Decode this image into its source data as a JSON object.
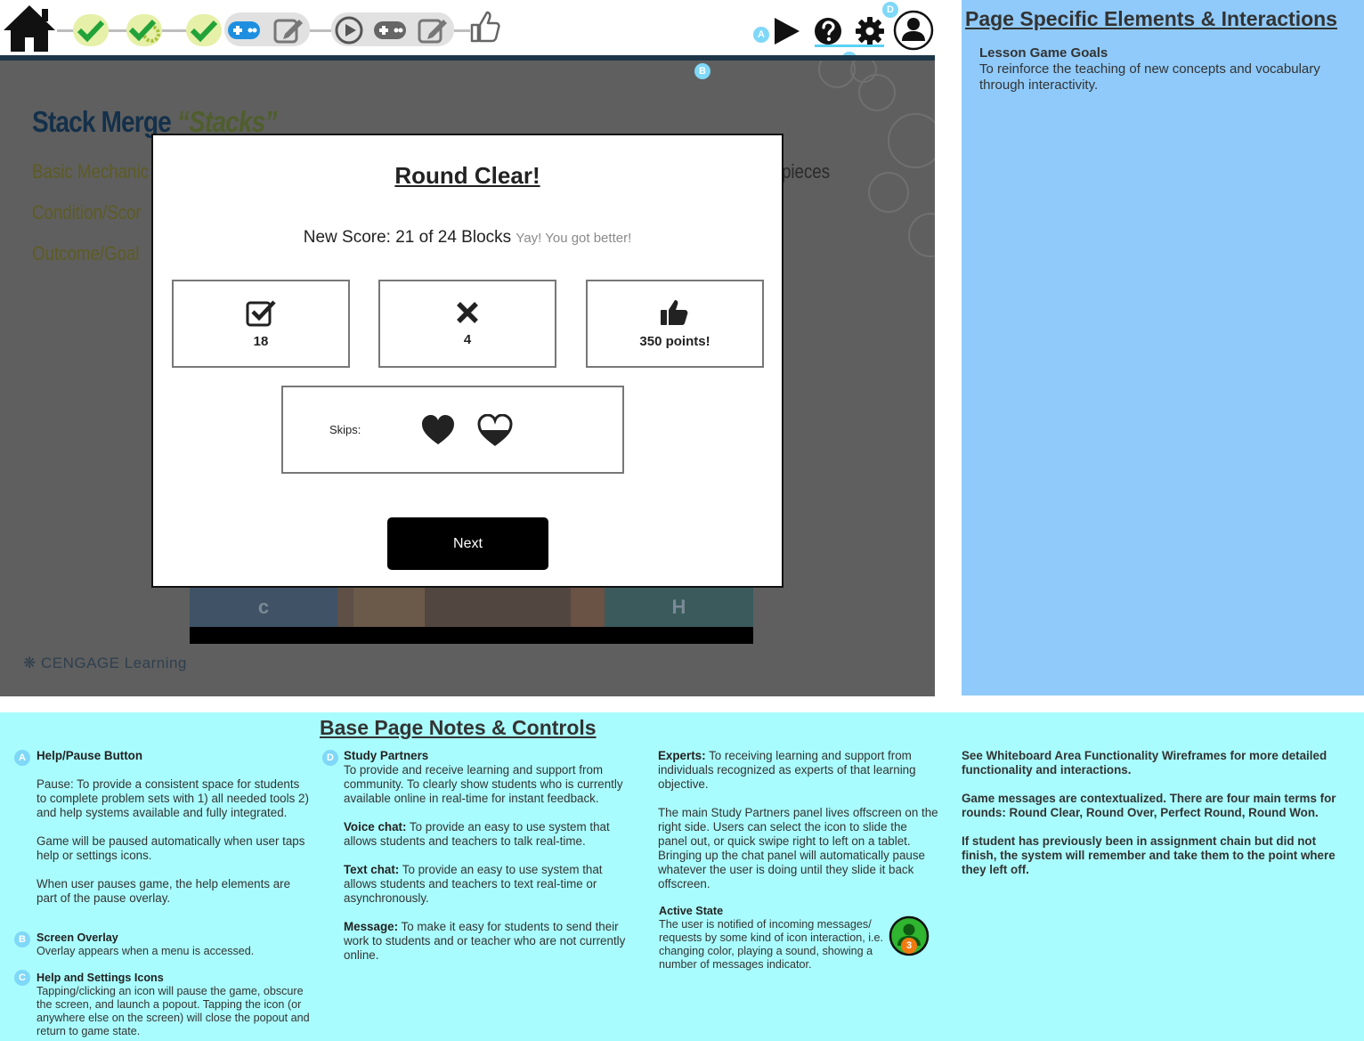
{
  "colors": {
    "topbar_line": "#1c3647",
    "overlay": "#5f5f5f",
    "marker": "#7fd8f7",
    "check_green": "#22a33a",
    "step_highlight": "#e6f0a8",
    "right_panel": "#8fcafa",
    "notes_bg": "#a9fcfd",
    "next_button": "#000000"
  },
  "nav": {
    "steps": [
      {
        "icon": "home-icon"
      },
      {
        "icon": "check-icon",
        "state": "done"
      },
      {
        "icon": "gear-check-icon",
        "state": "done"
      },
      {
        "icon": "check-icon",
        "state": "done"
      },
      {
        "icon": "gamepad-icon",
        "state": "current"
      },
      {
        "icon": "pencil-icon",
        "state": "pending"
      },
      {
        "icon": "play-circle-icon",
        "state": "pending"
      },
      {
        "icon": "gamepad-icon",
        "state": "pending"
      },
      {
        "icon": "pencil-icon",
        "state": "pending"
      },
      {
        "icon": "thumbs-up-icon",
        "state": "pending"
      }
    ]
  },
  "controls": {
    "play": "play-icon",
    "help": "help-icon",
    "settings": "gear-icon",
    "profile": "profile-icon"
  },
  "markers": {
    "a": "A",
    "b": "B",
    "c": "C",
    "d": "D"
  },
  "game": {
    "title_main": "Stack Merge ",
    "title_accent": "“Stacks”",
    "lines": [
      "Basic Mechanic",
      "Condition/Scor",
      "Outcome/Goal"
    ],
    "pieces_text": "pieces",
    "blocks": [
      "c",
      "",
      "",
      "",
      "",
      "H"
    ],
    "brand": "CENGAGE Learning"
  },
  "modal": {
    "title": "Round Clear!",
    "score": "New Score: 21 of 24 Blocks",
    "cheer": "Yay! You got better!",
    "correct_count": "18",
    "wrong_count": "4",
    "points": "350 points!",
    "skips_label": "Skips:",
    "next_label": "Next"
  },
  "right_panel": {
    "title": "Page Specific Elements & Interactions",
    "subtitle": "Lesson Game Goals",
    "text": "To reinforce the teaching of new concepts and vocabulary through interactivity."
  },
  "notes": {
    "title": "Base Page Notes & Controls",
    "a_title": "Help/Pause Button",
    "a_p1": "Pause: To provide a consistent space for students to complete problem sets with 1) all needed tools 2) and help systems available and fully integrated.",
    "a_p2": "Game will be paused automatically when user taps help or settings icons.",
    "a_p3": "When user pauses game, the help elements are part of the pause overlay.",
    "b_title": "Screen Overlay",
    "b_text": "Overlay appears when a menu is accessed.",
    "c_title": "Help and Settings Icons",
    "c_text": "Tapping/clicking an icon will pause the game, obscure the screen, and launch a popout. Tapping the icon (or anywhere else on the screen) will close the popout and return to game state.",
    "d_title": "Study Partners",
    "d_text": "To provide and receive learning and support from community. To clearly show students who is currently available online in real-time for instant feedback.",
    "voice_label": "Voice chat:",
    "voice_text": " To provide an easy to use system that allows students and teachers to talk real-time.",
    "text_label": "Text chat:",
    "text_text": " To provide an easy to use system that allows students and teachers to text real-time or asynchronously.",
    "msg_label": "Message:",
    "msg_text": " To make it easy for students to send their work to students and or teacher who are not currently online.",
    "experts_label": "Experts:",
    "experts_text": " To receiving learning and support from individuals recognized as experts of that learning objective.",
    "panel_text": "The main Study Partners panel lives offscreen on the right side. Users can select the icon to slide the panel out, or quick swipe right to left on a tablet. Bringing up the chat panel will automatically pause whatever the user is doing until they slide it back offscreen.",
    "active_title": "Active State",
    "active_text": "The user is notified of incoming messages/ requests by some kind of icon interaction, i.e. changing color, playing a sound, showing a number of messages indicator.",
    "active_badge": "3",
    "col4_p1": "See Whiteboard Area Functionality Wireframes for more detailed functionality and interactions.",
    "col4_p2": "Game messages are contextualized. There are four main terms for rounds: Round Clear, Round Over, Perfect Round, Round Won.",
    "col4_p3": "If student has previously been in assignment chain but did not finish, the system will remember and take them to the point where they left off."
  }
}
